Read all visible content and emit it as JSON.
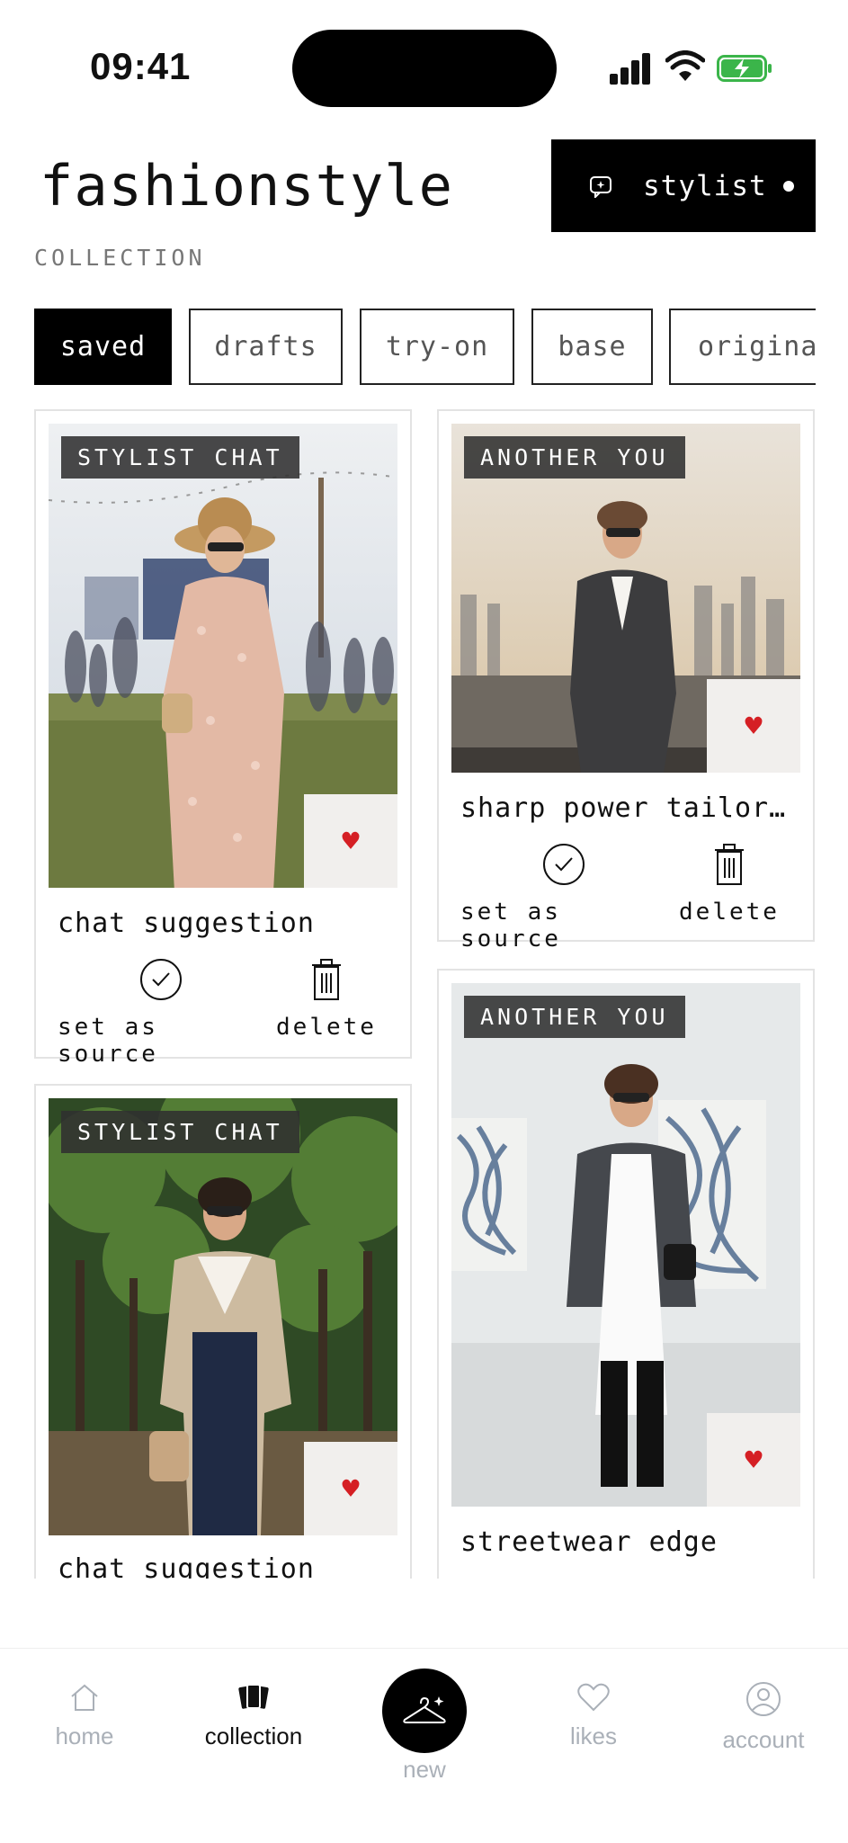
{
  "status_bar": {
    "time": "09:41"
  },
  "header": {
    "brand": "fashionstyle",
    "stylist_button": "stylist",
    "section_label": "COLLECTION"
  },
  "filters": [
    "saved",
    "drafts",
    "try-on",
    "base",
    "original"
  ],
  "active_filter": "saved",
  "cards": [
    {
      "badge": "STYLIST CHAT",
      "title": "chat suggestion",
      "liked": true,
      "source_label": "set as source",
      "delete_label": "delete"
    },
    {
      "badge": "ANOTHER YOU",
      "title": "sharp power tailori…",
      "liked": true,
      "source_label": "set as source",
      "delete_label": "delete"
    },
    {
      "badge": "STYLIST CHAT",
      "title": "chat suggestion",
      "liked": true
    },
    {
      "badge": "ANOTHER YOU",
      "title": "streetwear edge",
      "liked": true
    }
  ],
  "nav": {
    "home": "home",
    "collection": "collection",
    "new": "new",
    "likes": "likes",
    "account": "account"
  },
  "colors": {
    "accent": "#000000",
    "heart": "#d51f24",
    "nav_inactive": "#aab0b8"
  }
}
